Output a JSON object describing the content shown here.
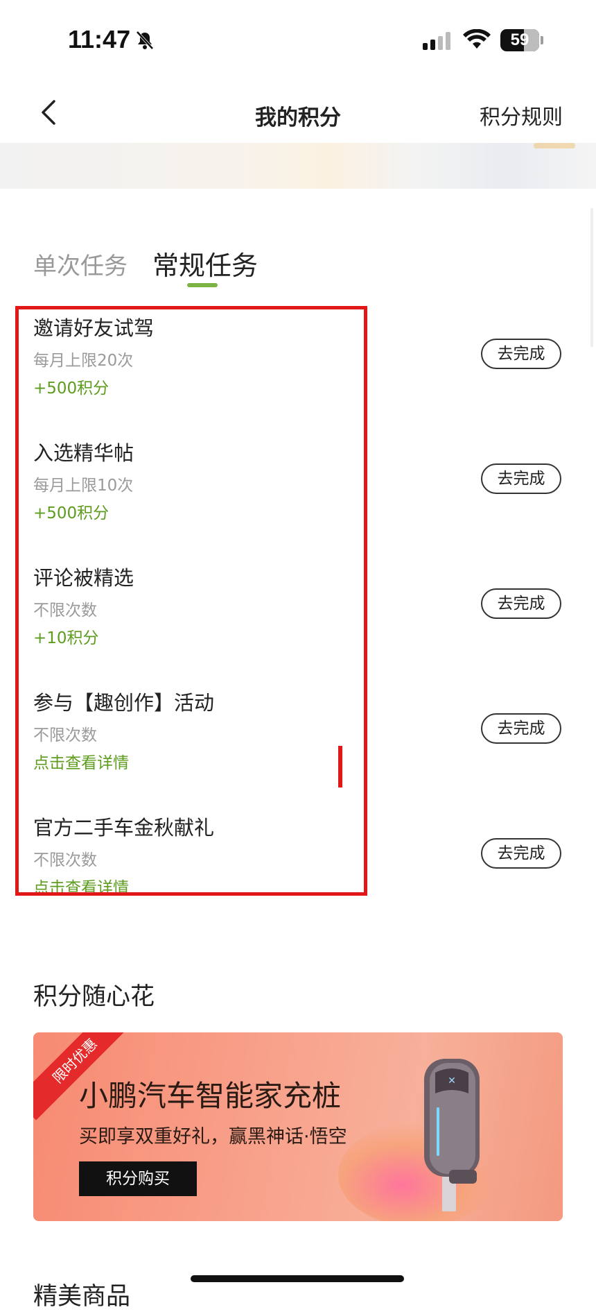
{
  "status_bar": {
    "time": "11:47",
    "battery": "59"
  },
  "nav": {
    "title": "我的积分",
    "rules_link": "积分规则"
  },
  "tabs": [
    {
      "label": "单次任务",
      "active": false
    },
    {
      "label": "常规任务",
      "active": true
    }
  ],
  "tasks": [
    {
      "title": "邀请好友试驾",
      "limit": "每月上限20次",
      "reward": "+500积分",
      "button": "去完成"
    },
    {
      "title": "入选精华帖",
      "limit": "每月上限10次",
      "reward": "+500积分",
      "button": "去完成"
    },
    {
      "title": "评论被精选",
      "limit": "不限次数",
      "reward": "+10积分",
      "button": "去完成"
    },
    {
      "title": "参与【趣创作】活动",
      "limit": "不限次数",
      "reward": "点击查看详情",
      "button": "去完成"
    },
    {
      "title": "官方二手车金秋献礼",
      "limit": "不限次数",
      "reward": "点击查看详情",
      "button": "去完成"
    }
  ],
  "redeem_section": {
    "title": "积分随心花",
    "promo": {
      "badge": "限时优惠",
      "title": "小鹏汽车智能家充桩",
      "subtitle": "买即享双重好礼，赢黑神话·悟空",
      "button": "积分购买"
    }
  },
  "next_section": {
    "title": "精美商品"
  },
  "colors": {
    "accent_green": "#5d9c1e",
    "tab_indicator": "#7cb342",
    "highlight_red": "#e01818"
  }
}
